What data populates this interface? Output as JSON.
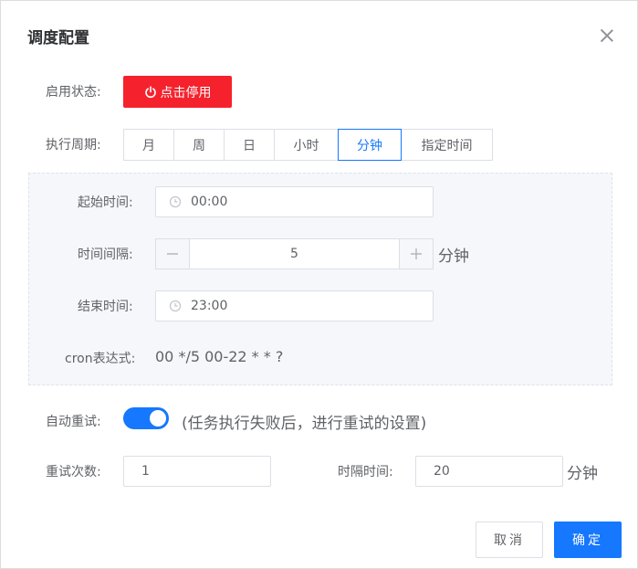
{
  "dialog": {
    "title": "调度配置"
  },
  "status": {
    "label": "启用状态:",
    "button_label": "点击停用",
    "button_color": "#f5222d"
  },
  "period": {
    "label": "执行周期:",
    "options": [
      "月",
      "周",
      "日",
      "小时",
      "分钟",
      "指定时间"
    ],
    "selected": "分钟"
  },
  "schedule": {
    "start_label": "起始时间:",
    "start_value": "00:00",
    "interval_label": "时间间隔:",
    "interval_value": "5",
    "interval_unit": "分钟",
    "end_label": "结束时间:",
    "end_value": "23:00",
    "cron_label": "cron表达式:",
    "cron_value": "00 */5 00-22 * * ?"
  },
  "retry": {
    "auto_label": "自动重试:",
    "auto_enabled": true,
    "auto_hint": "(任务执行失败后，进行重试的设置)",
    "count_label": "重试次数:",
    "count_value": "1",
    "gap_label": "时隔时间:",
    "gap_value": "20",
    "gap_unit": "分钟"
  },
  "footer": {
    "cancel_label": "取消",
    "ok_label": "确定"
  },
  "colors": {
    "primary": "#1677ff",
    "danger": "#f5222d"
  }
}
